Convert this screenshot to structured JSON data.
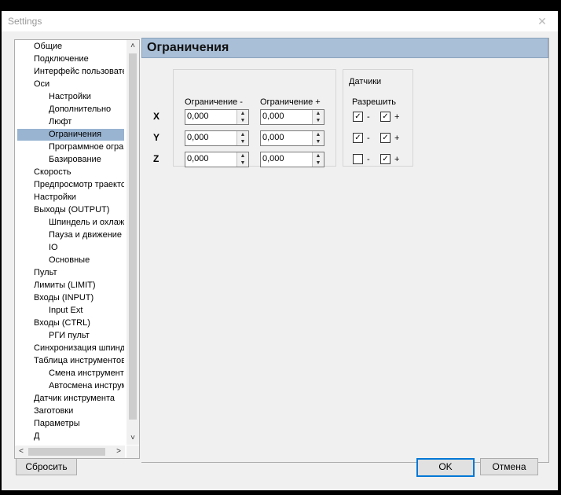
{
  "window": {
    "title": "Settings",
    "close_glyph": "✕"
  },
  "tree": {
    "items": [
      {
        "label": "Общие",
        "level": 0
      },
      {
        "label": "Подключение",
        "level": 0
      },
      {
        "label": "Интерфейс пользовате",
        "level": 0
      },
      {
        "label": "Оси",
        "level": 0
      },
      {
        "label": "Настройки",
        "level": 1
      },
      {
        "label": "Дополнительно",
        "level": 1
      },
      {
        "label": "Люфт",
        "level": 1
      },
      {
        "label": "Ограничения",
        "level": 1,
        "selected": true
      },
      {
        "label": "Программное огра",
        "level": 1
      },
      {
        "label": "Базирование",
        "level": 1
      },
      {
        "label": "Скорость",
        "level": 0
      },
      {
        "label": "Предпросмотр траекто",
        "level": 0
      },
      {
        "label": "Настройки",
        "level": 0
      },
      {
        "label": "Выходы (OUTPUT)",
        "level": 0
      },
      {
        "label": "Шпиндель и охлажд",
        "level": 1
      },
      {
        "label": "Пауза и движение",
        "level": 1
      },
      {
        "label": "IO",
        "level": 1
      },
      {
        "label": "Основные",
        "level": 1
      },
      {
        "label": "Пульт",
        "level": 0
      },
      {
        "label": "Лимиты (LIMIT)",
        "level": 0
      },
      {
        "label": "Входы (INPUT)",
        "level": 0
      },
      {
        "label": "Input Ext",
        "level": 1
      },
      {
        "label": "Входы (CTRL)",
        "level": 0
      },
      {
        "label": "РГИ пульт",
        "level": 1
      },
      {
        "label": "Синхронизация шпинде",
        "level": 0
      },
      {
        "label": "Таблица инструментов",
        "level": 0
      },
      {
        "label": "Смена инструмента",
        "level": 1
      },
      {
        "label": "Автосмена инструм",
        "level": 1
      },
      {
        "label": "Датчик инструмента",
        "level": 0
      },
      {
        "label": "Заготовки",
        "level": 0
      },
      {
        "label": "Параметры",
        "level": 0
      },
      {
        "label": "Д",
        "level": 0
      }
    ],
    "scroll_up_glyph": "˄",
    "scroll_down_glyph": "˅",
    "scroll_left_glyph": "<",
    "scroll_right_glyph": ">"
  },
  "panel": {
    "title": "Ограничения",
    "limit_min_header": "Ограничение -",
    "limit_max_header": "Ограничение +",
    "sensors_title": "Датчики",
    "allow_label": "Разрешить",
    "axes": [
      {
        "name": "X",
        "min": "0,000",
        "max": "0,000",
        "sensor_minus": true,
        "sensor_plus": true
      },
      {
        "name": "Y",
        "min": "0,000",
        "max": "0,000",
        "sensor_minus": true,
        "sensor_plus": true
      },
      {
        "name": "Z",
        "min": "0,000",
        "max": "0,000",
        "sensor_minus": false,
        "sensor_plus": true
      }
    ],
    "minus_label": "-",
    "plus_label": "+",
    "check_glyph": "✓",
    "spin_up_glyph": "▲",
    "spin_down_glyph": "▼"
  },
  "buttons": {
    "reset": "Сбросить",
    "ok": "OK",
    "cancel": "Отмена"
  },
  "colors": {
    "selected_item": "#99b4d1",
    "header_bg": "#a9bfd7",
    "default_button_border": "#0078d7"
  }
}
